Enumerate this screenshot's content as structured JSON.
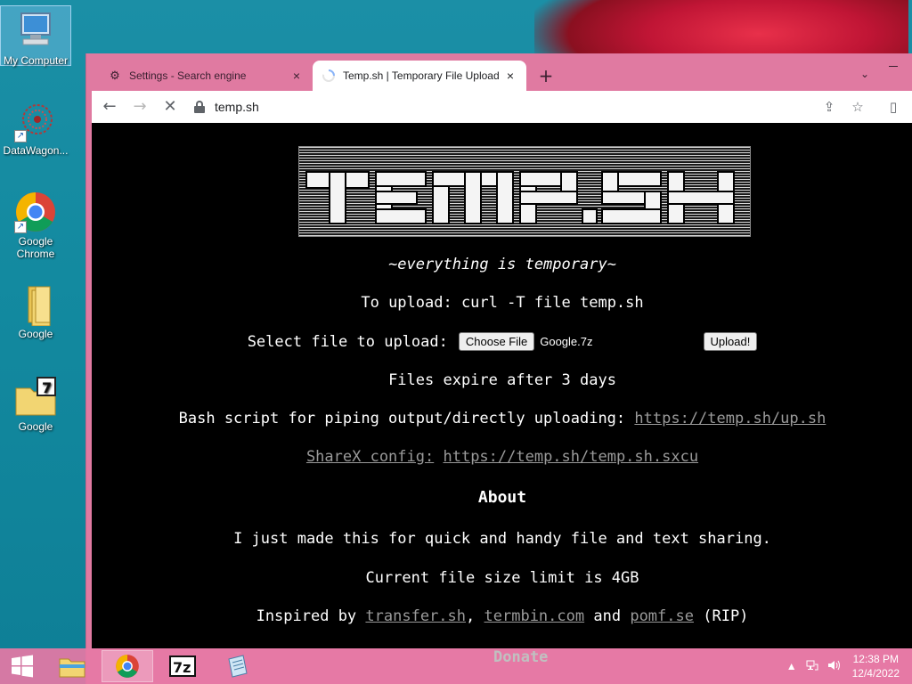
{
  "desktop": {
    "icons": [
      {
        "label": "My Computer"
      },
      {
        "label": "DataWagon..."
      },
      {
        "label": "Google Chrome"
      },
      {
        "label": "Google"
      },
      {
        "label": "Google"
      }
    ]
  },
  "browser": {
    "tabs": [
      {
        "title": "Settings - Search engine",
        "icon": "gear-icon",
        "close": "×"
      },
      {
        "title": "Temp.sh | Temporary File Upload",
        "icon": "loading-spinner-icon",
        "close": "×"
      }
    ],
    "new_tab": "+",
    "tab_menu": "⌄",
    "url": "temp.sh",
    "nav": {
      "back": "←",
      "forward": "→",
      "stop": "✕"
    },
    "toolbar_right": {
      "share": "⇪",
      "bookmark": "☆",
      "sidepanel": "▯"
    }
  },
  "page": {
    "tagline": "~everything is temporary~",
    "upload_hint": "To upload: curl -T file temp.sh",
    "select_label": "Select file to upload:",
    "choose_file": "Choose File",
    "file_name": "Google.7z",
    "upload_button": "Upload!",
    "expire": "Files expire after 3 days",
    "bash_label": "Bash script for piping output/directly uploading:",
    "bash_link": "https://temp.sh/up.sh",
    "sharex_label": "ShareX config:",
    "sharex_link": "https://temp.sh/temp.sh.sxcu",
    "about_heading": "About",
    "made": "I just made this for quick and handy file and text sharing.",
    "limit": "Current file size limit is 4GB",
    "inspired_prefix": "Inspired by",
    "inspired_link1": "transfer.sh",
    "inspired_comma": ",",
    "inspired_link2": "termbin.com",
    "inspired_and": "and",
    "inspired_link3": "pomf.se",
    "inspired_suffix": "(RIP)",
    "donate": "Donate"
  },
  "taskbar": {
    "time": "12:38 PM",
    "date": "12/4/2022"
  },
  "colors": {
    "browser_frame": "#e07aa1",
    "page_bg": "#000000",
    "link": "#9a9a9a"
  }
}
